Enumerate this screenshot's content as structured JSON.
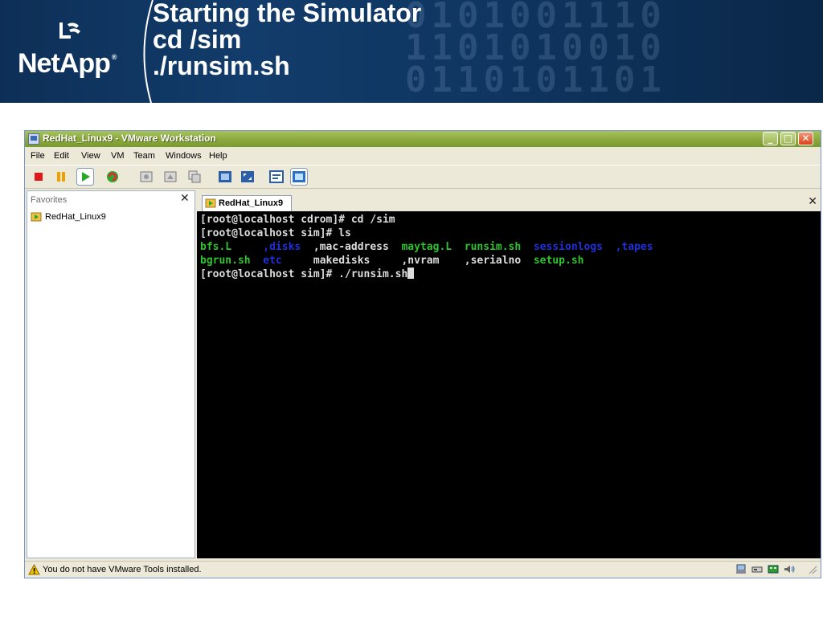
{
  "slide": {
    "logo_text": "NetApp",
    "logo_reg": "®",
    "title_lines": [
      "Starting the Simulator",
      "cd /sim",
      "./runsim.sh"
    ]
  },
  "window": {
    "title": "RedHat_Linux9 - VMware Workstation",
    "controls": {
      "minimize": "_",
      "maximize": "□",
      "close": "✕"
    },
    "menu": [
      "File",
      "Edit",
      "View",
      "VM",
      "Team",
      "Windows",
      "Help"
    ],
    "toolbar_icons": [
      "power-off-icon",
      "suspend-icon",
      "power-on-icon",
      "reset-icon",
      "snapshot-icon",
      "revert-snapshot-icon",
      "snapshot-manager-icon",
      "full-screen-icon",
      "quick-switch-icon",
      "summary-view-icon",
      "console-view-icon"
    ]
  },
  "favorites": {
    "title": "Favorites",
    "close": "✕",
    "items": [
      "RedHat_Linux9"
    ]
  },
  "console": {
    "tab_label": "RedHat_Linux9",
    "tab_close": "✕",
    "lines": [
      [
        {
          "text": "[root@localhost cdrom]# cd /sim",
          "color": "white"
        }
      ],
      [
        {
          "text": "[root@localhost sim]# ls",
          "color": "white"
        }
      ],
      [
        {
          "text": "bfs.L     ",
          "color": "green"
        },
        {
          "text": ",disks  ",
          "color": "blue"
        },
        {
          "text": ",mac-address  ",
          "color": "white"
        },
        {
          "text": "maytag.L  ",
          "color": "green"
        },
        {
          "text": "runsim.sh  ",
          "color": "green"
        },
        {
          "text": "sessionlogs  ",
          "color": "blue"
        },
        {
          "text": ",tapes",
          "color": "blue"
        }
      ],
      [
        {
          "text": "bgrun.sh  ",
          "color": "green"
        },
        {
          "text": "etc     ",
          "color": "blue"
        },
        {
          "text": "makedisks     ",
          "color": "white"
        },
        {
          "text": ",nvram    ",
          "color": "white"
        },
        {
          "text": ",serialno  ",
          "color": "white"
        },
        {
          "text": "setup.sh",
          "color": "green"
        }
      ],
      [
        {
          "text": "[root@localhost sim]# ./runsim.sh",
          "color": "white"
        }
      ]
    ]
  },
  "status": {
    "message": "You do not have VMware Tools installed.",
    "tray_icons": [
      "network-icon",
      "hard-disk-icon",
      "network-adapter-icon",
      "sound-icon"
    ]
  },
  "colors": {
    "terminal_bg": "#000000",
    "terminal_white": "#dcdcdc",
    "terminal_green": "#2fc32f",
    "terminal_blue": "#2030d8",
    "header_bg": "#123c6b",
    "titlebar": "#8aa83e"
  }
}
